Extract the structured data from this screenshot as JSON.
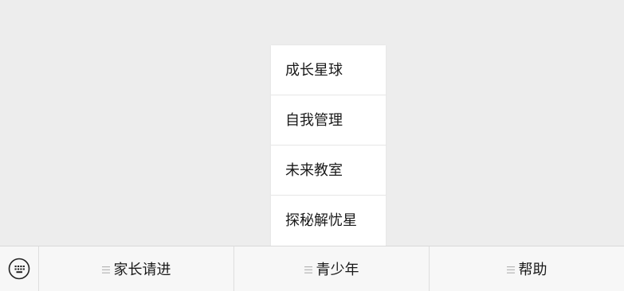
{
  "popup_menu": {
    "items": [
      {
        "label": "成长星球"
      },
      {
        "label": "自我管理"
      },
      {
        "label": "未来教室"
      },
      {
        "label": "探秘解忧星"
      }
    ]
  },
  "menu_bar": {
    "keyboard_icon": "keyboard-icon",
    "tabs": [
      {
        "label": "家长请进",
        "icon": "submenu-lines-icon"
      },
      {
        "label": "青少年",
        "icon": "submenu-lines-icon"
      },
      {
        "label": "帮助",
        "icon": "submenu-lines-icon"
      }
    ]
  }
}
